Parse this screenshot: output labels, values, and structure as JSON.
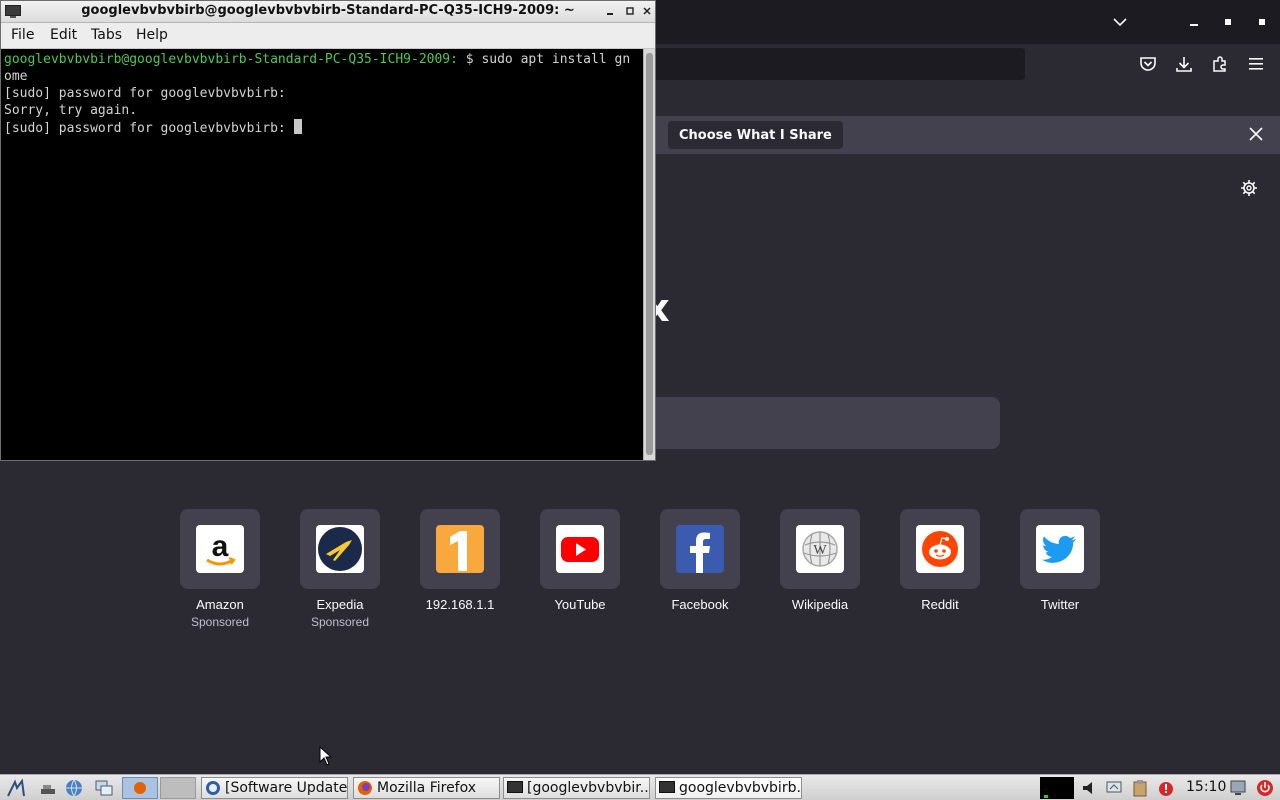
{
  "terminal": {
    "title": "googlevbvbvbirb@googlevbvbvbirb-Standard-PC-Q35-ICH9-2009: ~",
    "menu": [
      "File",
      "Edit",
      "Tabs",
      "Help"
    ],
    "prompt_user_host": "googlevbvbvbirb@googlevbvbvbirb-Standard-PC-Q35-ICH9-2009:",
    "prompt_path": " $ ",
    "command_line1": "sudo apt install gn",
    "command_line2": "ome",
    "output_line1": "[sudo] password for googlevbvbvbirb:",
    "output_line2": "Sorry, try again.",
    "output_line3": "[sudo] password for googlevbvbvbirb: "
  },
  "firefox": {
    "notice_button": "Choose What I Share",
    "brand_word": "refox",
    "shortcuts": [
      {
        "label": "Amazon",
        "sub": "Sponsored",
        "icon": "amazon-icon"
      },
      {
        "label": "Expedia",
        "sub": "Sponsored",
        "icon": "expedia-icon"
      },
      {
        "label": "192.168.1.1",
        "sub": "",
        "icon": "number-one-icon"
      },
      {
        "label": "YouTube",
        "sub": "",
        "icon": "youtube-icon"
      },
      {
        "label": "Facebook",
        "sub": "",
        "icon": "facebook-icon"
      },
      {
        "label": "Wikipedia",
        "sub": "",
        "icon": "wikipedia-icon"
      },
      {
        "label": "Reddit",
        "sub": "",
        "icon": "reddit-icon"
      },
      {
        "label": "Twitter",
        "sub": "",
        "icon": "twitter-icon"
      }
    ]
  },
  "taskbar": {
    "tasks": [
      "[Software Updater]",
      "Mozilla Firefox",
      "[googlevbvbvbir...",
      "googlevbvbvbirb..."
    ],
    "clock": "15:10"
  },
  "colors": {
    "firefox_bg": "#2b2a33",
    "terminal_prompt": "#4ec94e",
    "terminal_bg": "#000000"
  }
}
